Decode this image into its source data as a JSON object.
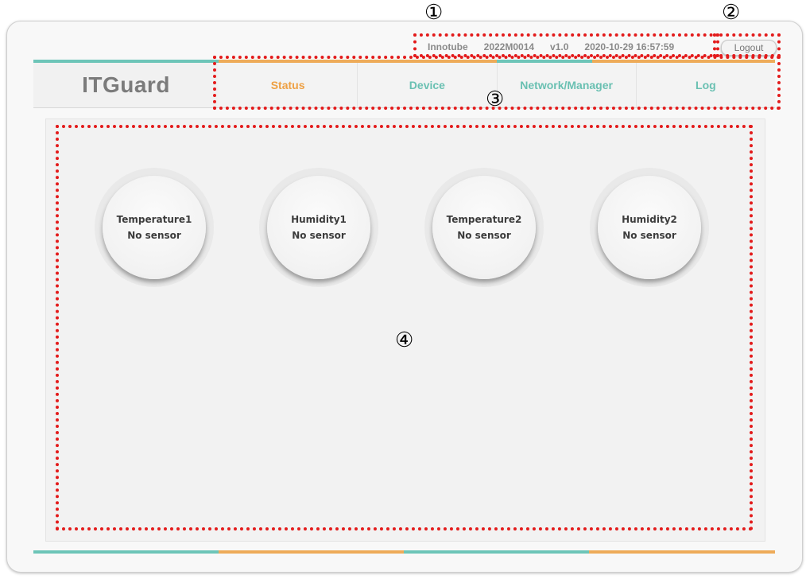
{
  "app": {
    "logo": "ITGuard"
  },
  "info_bar": {
    "company": "Innotube",
    "device_id": "2022M0014",
    "version": "v1.0",
    "datetime": "2020-10-29 16:57:59"
  },
  "logout": {
    "label": "Logout"
  },
  "nav": {
    "tabs": [
      {
        "label": "Status",
        "active": true
      },
      {
        "label": "Device",
        "active": false
      },
      {
        "label": "Network/Manager",
        "active": false
      },
      {
        "label": "Log",
        "active": false
      }
    ]
  },
  "sensors": [
    {
      "name": "Temperature1",
      "status": "No sensor"
    },
    {
      "name": "Humidity1",
      "status": "No sensor"
    },
    {
      "name": "Temperature2",
      "status": "No sensor"
    },
    {
      "name": "Humidity2",
      "status": "No sensor"
    }
  ],
  "annotations": {
    "n1": "①",
    "n2": "②",
    "n3": "③",
    "n4": "④"
  },
  "colors": {
    "teal": "#6dc5b8",
    "orange": "#eeab59",
    "annotation_red": "#e31b1b"
  }
}
